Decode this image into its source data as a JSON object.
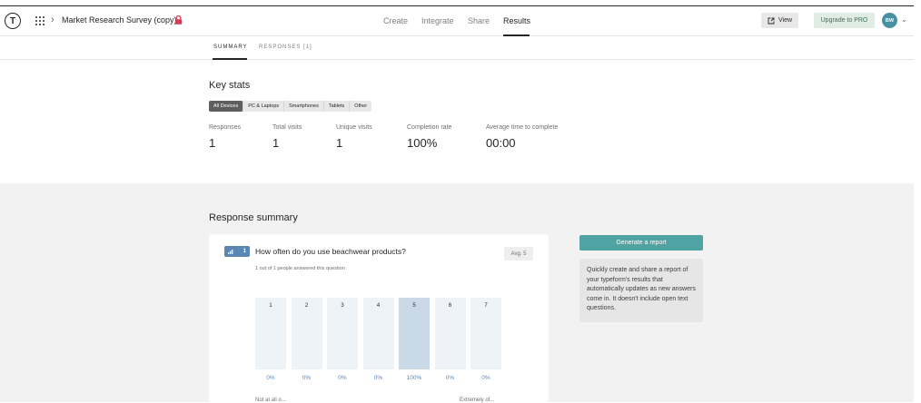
{
  "header": {
    "logo_letter": "T",
    "workspace_title": "Market Research Survey (copy)",
    "nav": [
      {
        "label": "Create"
      },
      {
        "label": "Integrate"
      },
      {
        "label": "Share"
      },
      {
        "label": "Results"
      }
    ],
    "view_label": "View",
    "upgrade_label": "Upgrade to PRO",
    "avatar_initials": "BW"
  },
  "subtabs": [
    {
      "label": "SUMMARY"
    },
    {
      "label": "RESPONSES [1]"
    }
  ],
  "key_stats": {
    "title": "Key stats",
    "devices": [
      "All Devices",
      "PC & Laptops",
      "Smartphones",
      "Tablets",
      "Other"
    ],
    "stats": [
      {
        "label": "Responses",
        "value": "1"
      },
      {
        "label": "Total visits",
        "value": "1"
      },
      {
        "label": "Unique visits",
        "value": "1"
      },
      {
        "label": "Completion rate",
        "value": "100%"
      },
      {
        "label": "Average time to complete",
        "value": "00:00"
      }
    ]
  },
  "response_summary": {
    "title": "Response summary",
    "question": {
      "number": "1",
      "title": "How often do you use beachwear products?",
      "answered": "1 out of 1 people answered this question",
      "avg": "Avg. 5",
      "options": [
        {
          "num": "1",
          "pct": "0%"
        },
        {
          "num": "2",
          "pct": "0%"
        },
        {
          "num": "3",
          "pct": "0%"
        },
        {
          "num": "4",
          "pct": "0%"
        },
        {
          "num": "5",
          "pct": "100%"
        },
        {
          "num": "6",
          "pct": "0%"
        },
        {
          "num": "7",
          "pct": "0%"
        }
      ],
      "scale_low": "Not at all o...",
      "scale_high": "Extremely of..."
    },
    "generate_label": "Generate a report",
    "info_text": "Quickly create and share a report of your typeform's results that automatically updates as new answers come in. It doesn't include open text questions."
  },
  "colors": {
    "accent": "#4fa3a2",
    "question_badge": "#5b86b4",
    "bar_filled": "#c9d9e8",
    "bar_empty": "#eef3f8"
  }
}
